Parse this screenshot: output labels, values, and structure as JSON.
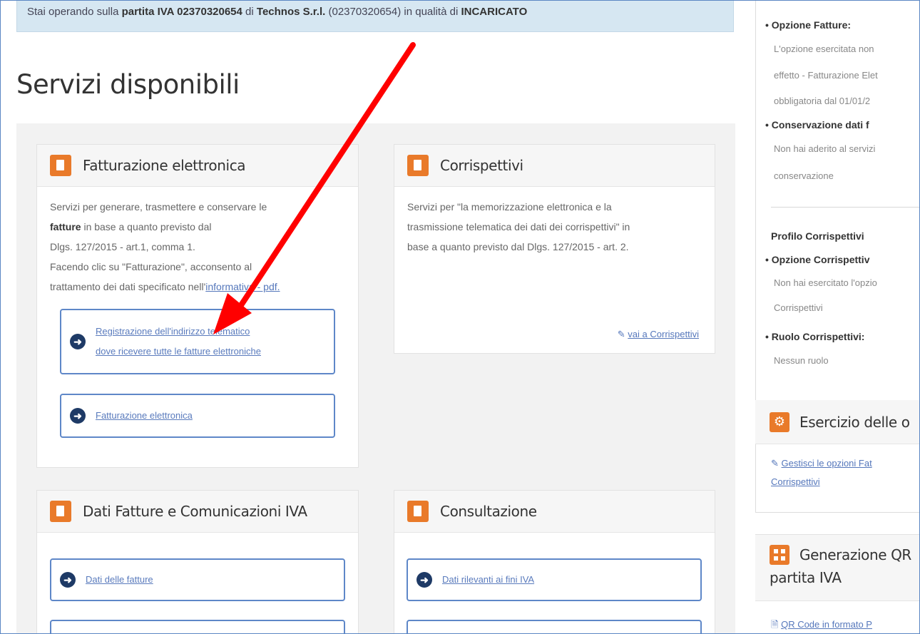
{
  "notice": {
    "prefix": "Stai operando sulla ",
    "piva_label": "partita IVA 02370320654",
    "middle": " di ",
    "company": "Technos S.r.l.",
    "code": " (02370320654) in qualità di ",
    "role": "INCARICATO"
  },
  "page_title": "Servizi disponibili",
  "cards": {
    "fatturazione": {
      "title": "Fatturazione elettronica",
      "text_1": "Servizi per generare, trasmettere e conservare le",
      "text_bold": "fatture",
      "text_2": " in base a quanto previsto dal",
      "text_3": "Dlgs. 127/2015 - art.1, comma 1.",
      "text_4": "Facendo clic su \"Fatturazione\", acconsento al",
      "text_5": "trattamento dei dati specificato nell'",
      "privacy_link": "informativa - pdf.",
      "btn_registrazione_1": "Registrazione dell'indirizzo telematico",
      "btn_registrazione_2": "dove ricevere tutte le fatture elettroniche",
      "btn_fatturazione": "Fatturazione elettronica"
    },
    "corrispettivi": {
      "title": "Corrispettivi",
      "text_1": "Servizi per \"la memorizzazione elettronica e la",
      "text_2": "trasmissione telematica dei dati dei corrispettivi\" in",
      "text_3": "base a quanto previsto dal Dlgs. 127/2015 - art. 2.",
      "link": "vai a Corrispettivi"
    },
    "dati_fatture": {
      "title": "Dati Fatture e Comunicazioni IVA",
      "btn_1": "Dati delle fatture"
    },
    "consultazione": {
      "title": "Consultazione",
      "btn_1": "Dati rilevanti ai fini IVA"
    }
  },
  "right_panel": {
    "opzione_fatture_label": "Opzione Fatture:",
    "opzione_fatture_1": "L'opzione esercitata non",
    "opzione_fatture_2": "effetto - Fatturazione Elet",
    "opzione_fatture_3": "obbligatoria dal 01/01/2",
    "conservazione_label": "Conservazione dati f",
    "conservazione_1": "Non hai aderito al servizi",
    "conservazione_2": "conservazione",
    "profilo_label": "Profilo Corrispettivi",
    "opzione_corr_label": "Opzione Corrispettiv",
    "opzione_corr_1": "Non hai esercitato l'opzio",
    "opzione_corr_2": "Corrispettivi",
    "ruolo_label": "Ruolo Corrispettivi:",
    "ruolo_value": "Nessun ruolo",
    "esercizio_title": "Esercizio delle o",
    "gestisci_link_1": "Gestisci le opzioni Fat",
    "gestisci_link_2": "Corrispettivi",
    "qr_title_1": "Generazione QR",
    "qr_title_2": "partita IVA",
    "qr_link": "QR Code in formato P"
  },
  "colors": {
    "accent_orange": "#e97a2a",
    "link_blue": "#5577bb",
    "annotation_red": "#ff0000"
  }
}
